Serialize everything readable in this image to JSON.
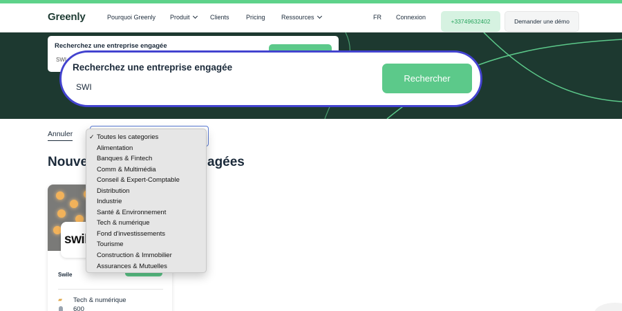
{
  "colors": {
    "accent_green": "#5cc98a",
    "hero_bg": "#1d3930",
    "focus_ring": "#4343cf",
    "dropdown_bg": "#e6e6e6"
  },
  "nav": {
    "logo": "Greenly",
    "items": [
      {
        "label": "Pourquoi Greenly",
        "dropdown": false
      },
      {
        "label": "Produit",
        "dropdown": true
      },
      {
        "label": "Clients",
        "dropdown": false
      },
      {
        "label": "Pricing",
        "dropdown": false
      },
      {
        "label": "Ressources",
        "dropdown": true
      }
    ],
    "lang": "FR",
    "login": "Connexion",
    "phone": "+33749632402",
    "demo": "Demander une démo"
  },
  "search_bg": {
    "title": "Recherchez une entreprise engagée",
    "value": "SWI"
  },
  "search": {
    "title": "Recherchez une entreprise engagée",
    "value": "SWI",
    "button": "Rechercher"
  },
  "filters": {
    "cancel": "Annuler",
    "category_options": [
      "Toutes les categories",
      "Alimentation",
      "Banques & Fintech",
      "Comm & Multimédia",
      "Conseil & Expert-Comptable",
      "Distribution",
      "Industrie",
      "Santé & Environnement",
      "Tech & numérique",
      "Fond d'investissements",
      "Tourisme",
      "Construction & Immobilier",
      "Assurances & Mutuelles"
    ],
    "selected_index": 0
  },
  "section": {
    "title_visible_start": "Nouve",
    "title_visible_end": "agées"
  },
  "card": {
    "logo_text": "swile",
    "name": "Swile",
    "category": "Tech & numérique",
    "employees": "600",
    "category_icon": "briefcase-icon",
    "employees_icon": "person-icon"
  }
}
